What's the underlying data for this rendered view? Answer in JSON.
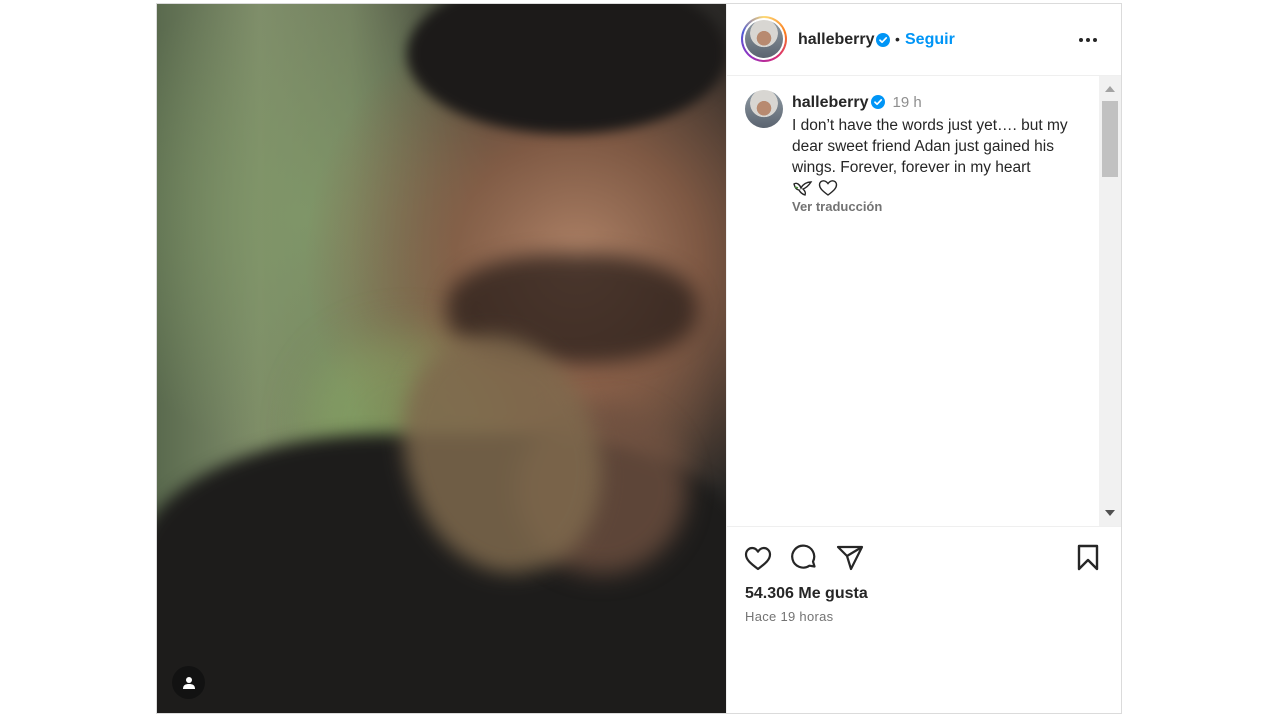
{
  "post": {
    "author": {
      "username": "halleberry",
      "verified": true
    },
    "header": {
      "dot": "•",
      "follow_label": "Seguir"
    },
    "caption": {
      "username": "halleberry",
      "time": "19 h",
      "text": "I don’t have the words just yet…. but my dear sweet friend Adan just gained his wings. Forever, forever in my heart",
      "emojis": [
        "dove-icon",
        "heart-outline-icon"
      ],
      "see_translation": "Ver traducción"
    },
    "actions": [
      "like-icon",
      "comment-icon",
      "share-icon",
      "save-icon"
    ],
    "likes_label": "54.306 Me gusta",
    "time_ago": "Hace 19 horas"
  },
  "colors": {
    "accent": "#0095f6",
    "verified": "#0095f6",
    "text": "#262626",
    "muted": "#737373"
  }
}
